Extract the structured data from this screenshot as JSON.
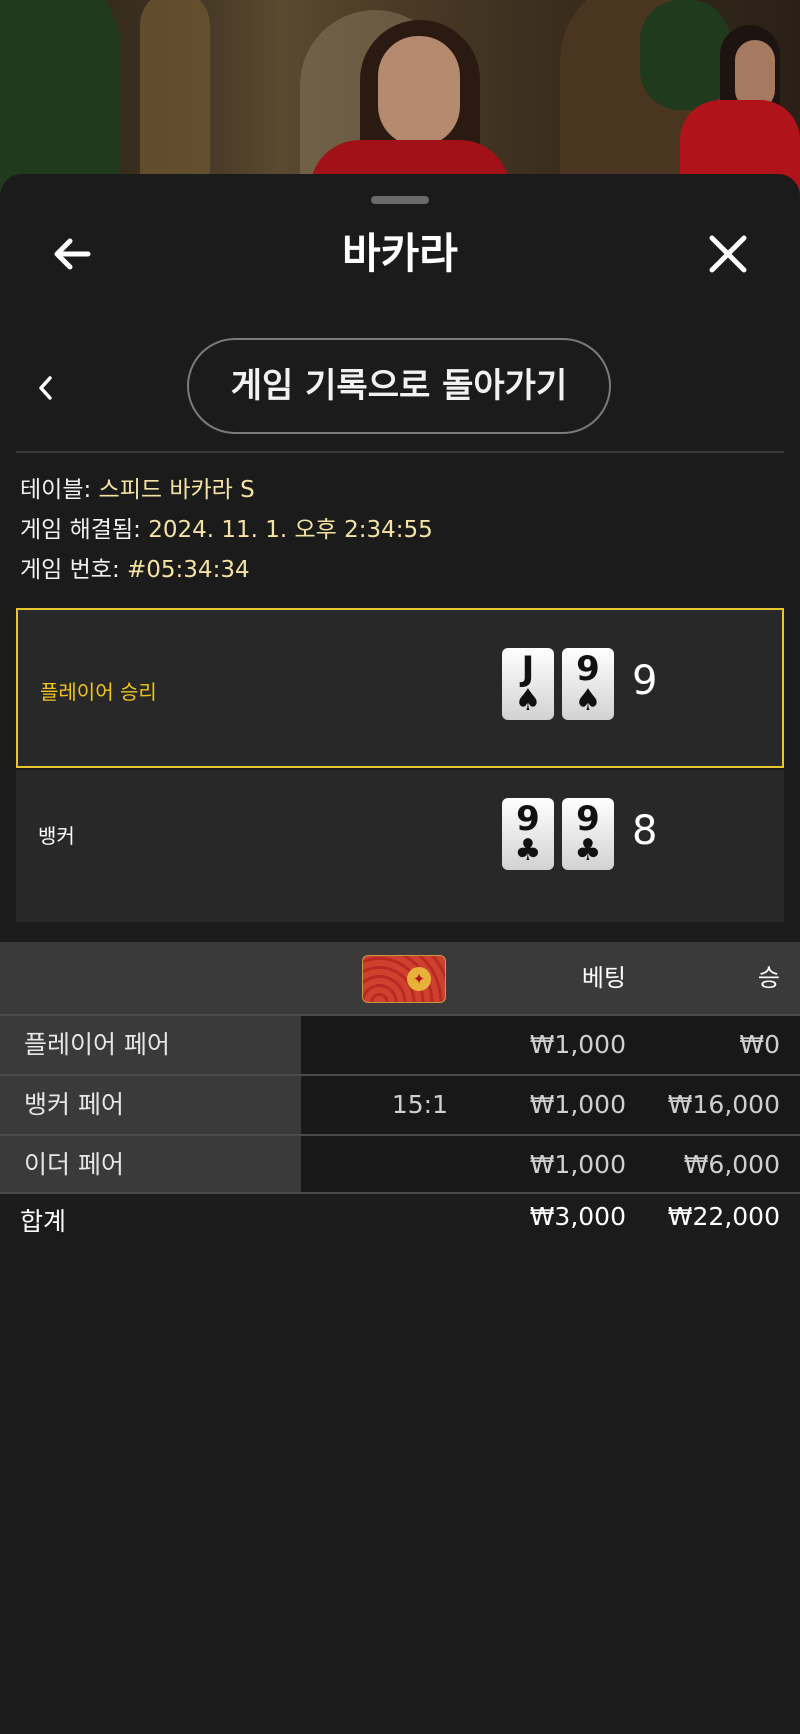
{
  "header": {
    "title": "바카라"
  },
  "nav": {
    "return_label": "게임 기록으로 돌아가기"
  },
  "info": {
    "table_label": "테이블:",
    "table_value": "스피드 바카라 S",
    "resolved_label": "게임 해결됨:",
    "resolved_value": "2024. 11. 1. 오후 2:34:55",
    "number_label": "게임 번호:",
    "number_value": "#05:34:34"
  },
  "hands": [
    {
      "label": "플레이어 승리",
      "winner": true,
      "cards": [
        {
          "rank": "J",
          "suit": "♠"
        },
        {
          "rank": "9",
          "suit": "♠"
        }
      ],
      "score": "9"
    },
    {
      "label": "뱅커",
      "winner": false,
      "cards": [
        {
          "rank": "9",
          "suit": "♣"
        },
        {
          "rank": "9",
          "suit": "♣"
        }
      ],
      "score": "8"
    }
  ],
  "bets": {
    "col_bet": "베팅",
    "col_win": "승",
    "rows": [
      {
        "name": "플레이어 페어",
        "odds": "",
        "bet": "₩1,000",
        "win": "₩0"
      },
      {
        "name": "뱅커 페어",
        "odds": "15:1",
        "bet": "₩1,000",
        "win": "₩16,000"
      },
      {
        "name": "이더 페어",
        "odds": "",
        "bet": "₩1,000",
        "win": "₩6,000"
      }
    ],
    "total": {
      "label": "합계",
      "bet": "₩3,000",
      "win": "₩22,000"
    }
  },
  "colors": {
    "accent": "#e8c631",
    "background": "#1b1b1b",
    "panel": "#282828"
  }
}
